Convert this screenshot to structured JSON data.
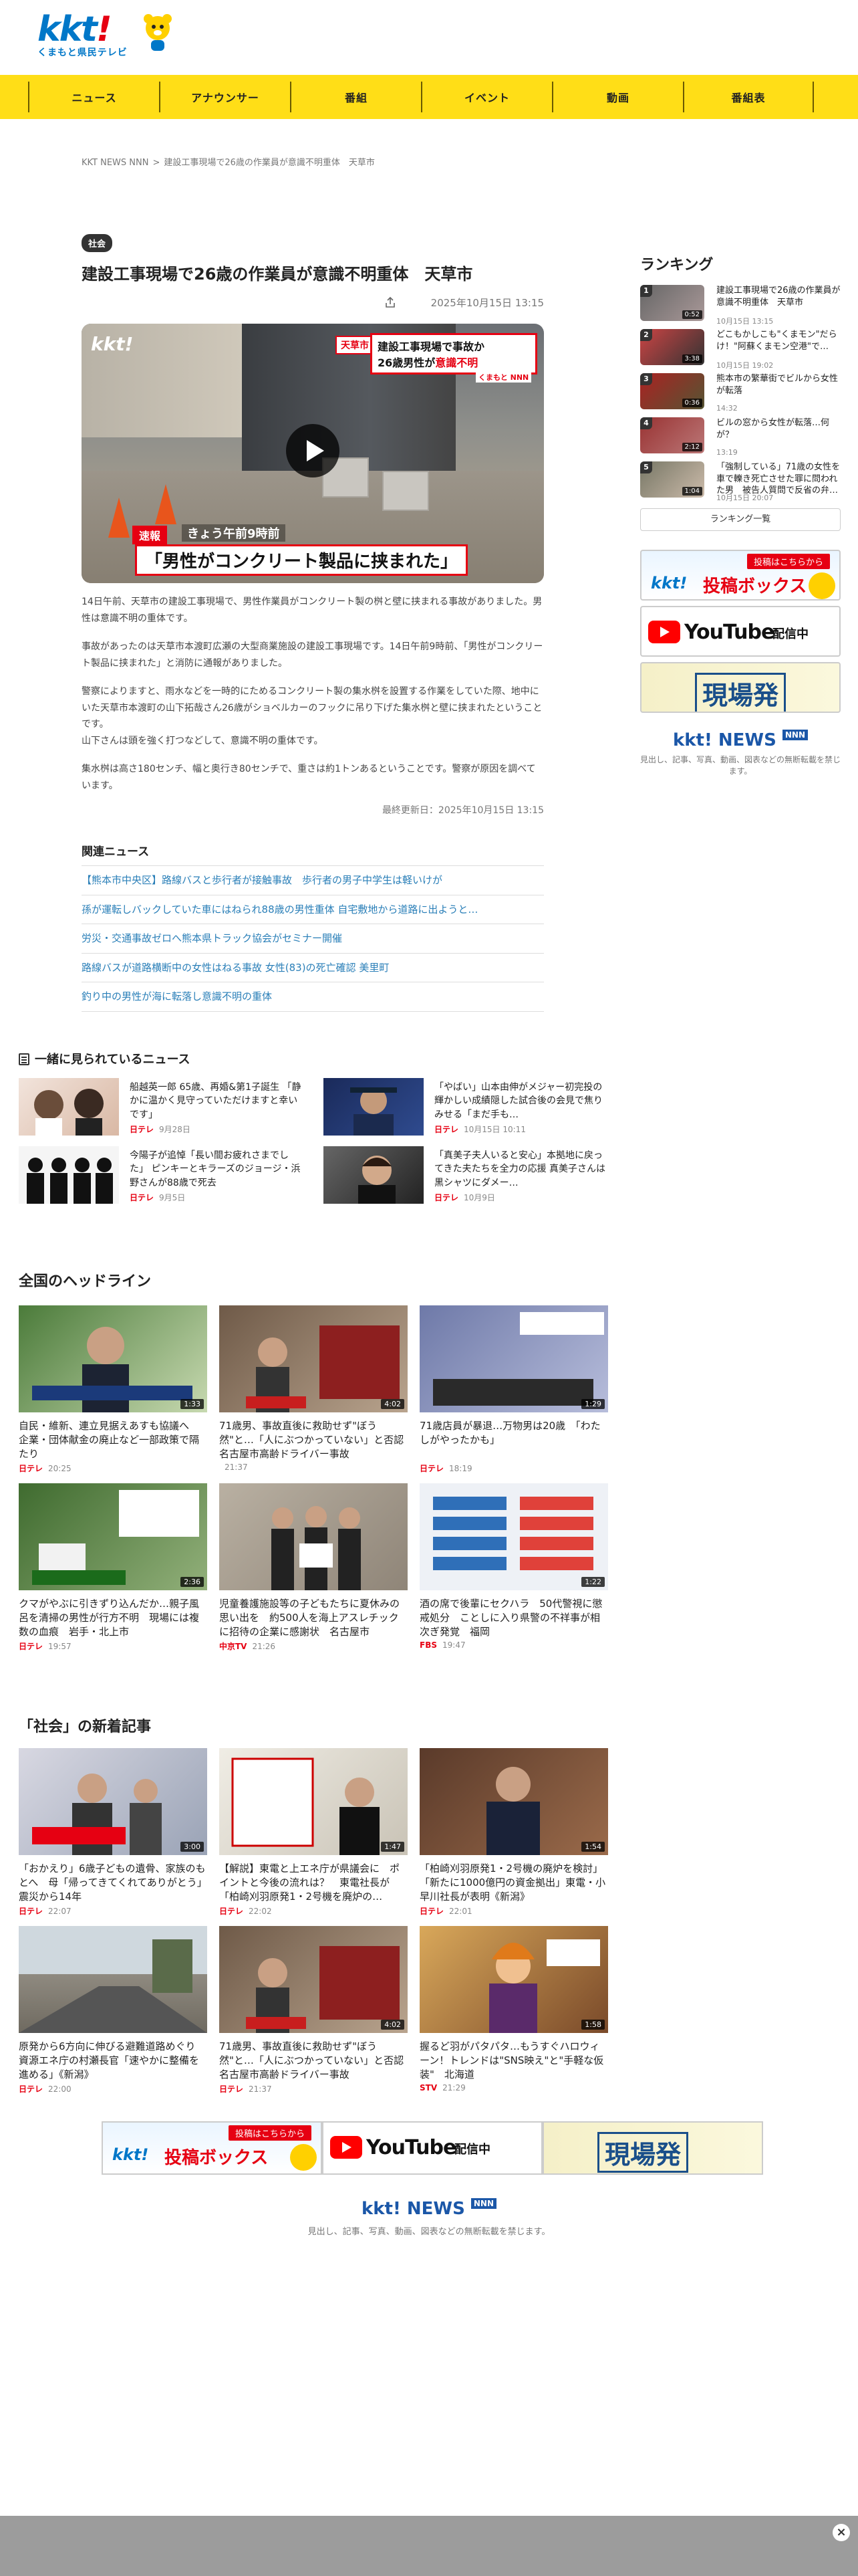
{
  "site": {
    "logo_text": "kkt!",
    "logo_sub": "くまもと県民テレビ"
  },
  "nav": [
    "ニュース",
    "アナウンサー",
    "番組",
    "イベント",
    "動画",
    "番組表"
  ],
  "breadcrumb": {
    "home": "KKT NEWS NNN",
    "current": "建設工事現場で26歳の作業員が意識不明重体　天草市"
  },
  "article": {
    "category": "社会",
    "title": "建設工事現場で26歳の作業員が意識不明重体　天草市",
    "date": "2025年10月15日 13:15",
    "video": {
      "watermark": "kkt!",
      "place": "天草市",
      "headline_line1": "建設工事現場で事故か",
      "headline_line2_prefix": "26歳男性が",
      "headline_line2_red": "意識不明",
      "brand": "くまもと NNN",
      "tag": "速報",
      "time_label": "きょう午前9時前",
      "quote": "「男性がコンクリート製品に挟まれた」"
    },
    "paragraphs": [
      "14日午前、天草市の建設工事現場で、男性作業員がコンクリート製の桝と壁に挟まれる事故がありました。男性は意識不明の重体です。",
      "事故があったのは天草市本渡町広瀬の大型商業施設の建設工事現場です。14日午前9時前、「男性がコンクリート製品に挟まれた」と消防に通報がありました。",
      "警察によりますと、雨水などを一時的にためるコンクリート製の集水桝を設置する作業をしていた際、地中にいた天草市本渡町の山下拓哉さん26歳がショベルカーのフックに吊り下げた集水桝と壁に挟まれたということです。\n山下さんは頭を強く打つなどして、意識不明の重体です。",
      "集水桝は高さ180センチ、幅と奥行き80センチで、重さは約1トンあるということです。警察が原因を調べています。"
    ],
    "updated": "最終更新日：2025年10月15日 13:15"
  },
  "related": {
    "title": "関連ニュース",
    "items": [
      "【熊本市中央区】路線バスと歩行者が接触事故　歩行者の男子中学生は軽いけが",
      "孫が運転しバックしていた車にはねられ88歳の男性重体 自宅敷地から道路に出ようと…",
      "労災・交通事故ゼロへ熊本県トラック協会がセミナー開催",
      "路線バスが道路横断中の女性はねる事故 女性(83)の死亡確認 美里町",
      "釣り中の男性が海に転落し意識不明の重体"
    ]
  },
  "sidebar": {
    "ranking_title": "ランキング",
    "ranking": [
      {
        "num": "1",
        "text": "建設工事現場で26歳の作業員が意識不明重体　天草市",
        "time": "10月15日 13:15",
        "dur": "0:52"
      },
      {
        "num": "2",
        "text": "どこもかしこも\"くまモン\"だらけ！\"阿蘇くまモン空港\"で…",
        "time": "10月15日 19:02",
        "dur": "3:38"
      },
      {
        "num": "3",
        "text": "熊本市の繁華街でビルから女性が転落",
        "time": "14:32",
        "dur": "0:36"
      },
      {
        "num": "4",
        "text": "ビルの窓から女性が転落…何が？",
        "time": "13:19",
        "dur": "2:12"
      },
      {
        "num": "5",
        "text": "「強制している」71歳の女性を車で轢き死亡させた罪に問われた男　被告人質問で反省の弁…",
        "time": "10月15日 20:07",
        "dur": "1:04"
      }
    ],
    "ranking_more": "ランキング一覧",
    "banner_post_ribbon": "投稿はこちらから",
    "banner_post_text": "投稿ボックス",
    "banner_yt_name": "YouTube",
    "banner_yt_live": "配信中",
    "banner_genba": "現場発",
    "news_logo": "kkt! NEWS",
    "news_nnn": "NNN",
    "note": "見出し、記事、写真、動画、図表などの無断転載を禁じます。"
  },
  "together": {
    "title": "一緒に見られているニュース",
    "items": [
      {
        "text": "船越英一郎 65歳、再婚&第1子誕生 「静かに温かく見守っていただけますと幸いです」",
        "src": "日テレ",
        "time": "9月28日"
      },
      {
        "text": "「やばい」山本由伸がメジャー初完投の輝かしい成績隠した試合後の会見で焦りみせる「まだ手も…",
        "src": "日テレ",
        "time": "10月15日 10:11"
      },
      {
        "text": "今陽子が追悼「長い間お疲れさまでした」 ピンキーとキラーズのジョージ・浜野さんが88歳で死去",
        "src": "日テレ",
        "time": "9月5日"
      },
      {
        "text": "「真美子夫人いると安心」本拠地に戻ってきた夫たちを全力の応援 真美子さんは黒シャツにダメー…",
        "src": "日テレ",
        "time": "10月9日"
      }
    ]
  },
  "headlines": {
    "title": "全国のヘッドライン",
    "items": [
      {
        "text": "自民・維新、連立見据えあすも協議へ　企業・団体献金の廃止など一部政策で隔たり",
        "src": "日テレ",
        "time": "20:25",
        "dur": "1:33"
      },
      {
        "text": "71歳男、事故直後に救助せず\"ぼう然\"と…「人にぶつかっていない」と否認　名古屋市高齢ドライバー事故",
        "src": "",
        "time": "21:37",
        "dur": "4:02"
      },
      {
        "text": "71歳店員が暴退…万物男は20歳　「わたしがやったかも」",
        "src": "日テレ",
        "time": "18:19",
        "dur": "1:29"
      },
      {
        "text": "クマがやぶに引きずり込んだか…親子風呂を清掃の男性が行方不明　現場には複数の血痕　岩手・北上市",
        "src": "日テレ",
        "time": "19:57",
        "dur": "2:36"
      },
      {
        "text": "児童養護施設等の子どもたちに夏休みの思い出を　約500人を海上アスレチックに招待の企業に感謝状　名古屋市",
        "src": "中京TV",
        "time": "21:26",
        "dur": ""
      },
      {
        "text": "酒の席で後輩にセクハラ　50代警視に懲戒処分　ことしに入り県警の不祥事が相次ぎ発覚　福岡",
        "src": "FBS",
        "time": "19:47",
        "dur": "1:22"
      }
    ]
  },
  "society": {
    "title": "「社会」の新着記事",
    "items": [
      {
        "text": "「おかえり」6歳子どもの遺骨、家族のもとへ　母「帰ってきてくれてありがとう」 震災から14年",
        "src": "日テレ",
        "time": "22:07",
        "dur": "3:00"
      },
      {
        "text": "【解説】東電と上エネ庁が県議会に　ポイントと今後の流れは？　東電社長が「柏崎刈羽原発1・2号機を廃炉の…",
        "src": "日テレ",
        "time": "22:02",
        "dur": "1:47"
      },
      {
        "text": "「柏崎刈羽原発1・2号機の廃炉を検討」「新たに1000億円の資金拠出」東電・小早川社長が表明《新潟》",
        "src": "日テレ",
        "time": "22:01",
        "dur": "1:54"
      },
      {
        "text": "原発から6方向に伸びる避難道路めぐり　資源エネ庁の村瀬長官「速やかに整備を進める」《新潟》",
        "src": "日テレ",
        "time": "22:00",
        "dur": ""
      },
      {
        "text": "71歳男、事故直後に救助せず\"ぼう然\"と…「人にぶつかっていない」と否認　名古屋市高齢ドライバー事故",
        "src": "日テレ",
        "time": "21:37",
        "dur": "4:02"
      },
      {
        "text": "握るど羽がパタパタ…もうすぐハロウィーン！トレンドは\"SNS映え\"と\"手軽な仮装\"　北海道",
        "src": "STV",
        "time": "21:29",
        "dur": "1:58"
      }
    ]
  },
  "footer": {
    "news_logo": "kkt! NEWS",
    "news_nnn": "NNN",
    "note": "見出し、記事、写真、動画、図表などの無断転載を禁じます。"
  },
  "bottom_bar": {
    "close": "×"
  }
}
